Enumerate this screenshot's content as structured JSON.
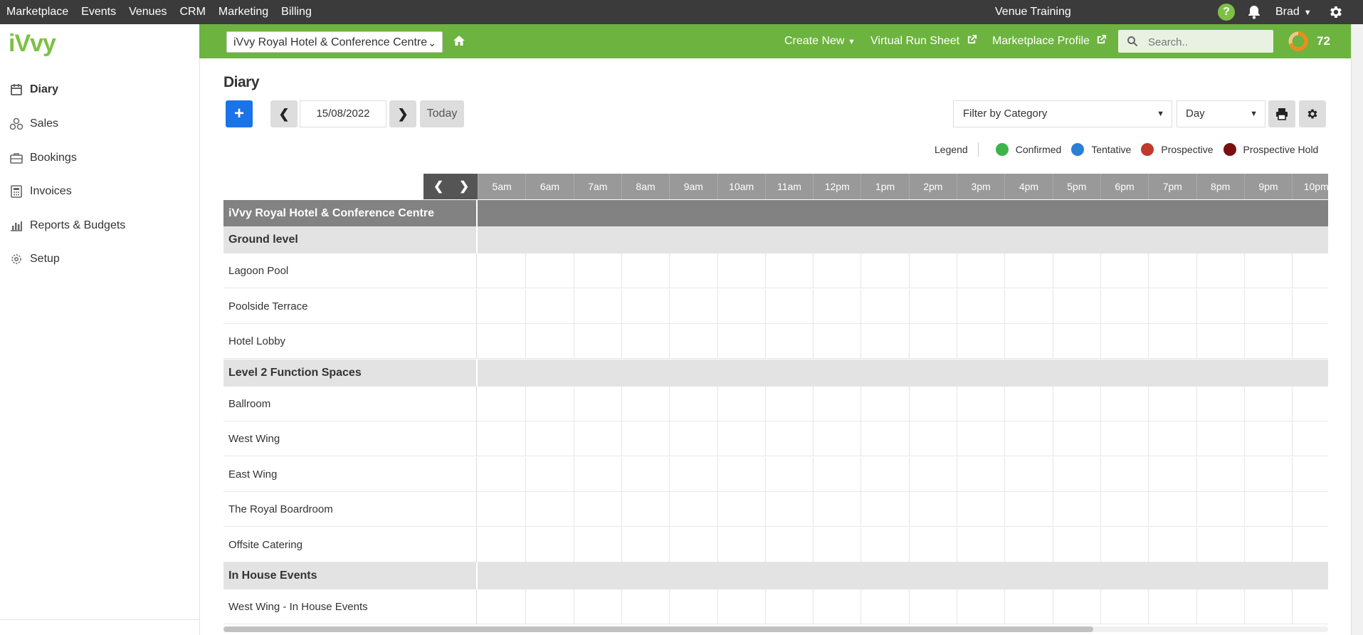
{
  "topnav": {
    "links": [
      "Marketplace",
      "Events",
      "Venues",
      "CRM",
      "Marketing",
      "Billing"
    ],
    "center_title": "Venue Training",
    "help_label": "?",
    "user": "Brad"
  },
  "sidebar": {
    "logo": "iVvy",
    "items": [
      {
        "label": "Diary",
        "icon": "calendar-icon",
        "active": true
      },
      {
        "label": "Sales",
        "icon": "sales-icon",
        "active": false
      },
      {
        "label": "Bookings",
        "icon": "briefcase-icon",
        "active": false
      },
      {
        "label": "Invoices",
        "icon": "calculator-icon",
        "active": false
      },
      {
        "label": "Reports & Budgets",
        "icon": "bar-chart-icon",
        "active": false
      },
      {
        "label": "Setup",
        "icon": "gear-icon",
        "active": false
      }
    ]
  },
  "greenbar": {
    "venue": "iVvy Royal Hotel & Conference Centre",
    "create_new": "Create New",
    "virtual_run_sheet": "Virtual Run Sheet",
    "marketplace_profile": "Marketplace Profile",
    "search_placeholder": "Search..",
    "score": "72"
  },
  "diary": {
    "title": "Diary",
    "add_label": "+",
    "date": "15/08/2022",
    "today_label": "Today",
    "filter_label": "Filter by Category",
    "view_label": "Day"
  },
  "legend": {
    "title": "Legend",
    "items": [
      {
        "label": "Confirmed",
        "color": "#3db34a"
      },
      {
        "label": "Tentative",
        "color": "#2a7fd4"
      },
      {
        "label": "Prospective",
        "color": "#c0392b"
      },
      {
        "label": "Prospective Hold",
        "color": "#7a1010"
      }
    ]
  },
  "grid": {
    "times": [
      "5am",
      "6am",
      "7am",
      "8am",
      "9am",
      "10am",
      "11am",
      "12pm",
      "1pm",
      "2pm",
      "3pm",
      "4pm",
      "5pm",
      "6pm",
      "7pm",
      "8pm",
      "9pm",
      "10pm"
    ],
    "venue_name": "iVvy Royal Hotel & Conference Centre",
    "groups": [
      {
        "name": "Ground level",
        "rooms": [
          "Lagoon Pool",
          "Poolside Terrace",
          "Hotel Lobby"
        ]
      },
      {
        "name": "Level 2 Function Spaces",
        "rooms": [
          "Ballroom",
          "West Wing",
          "East Wing",
          "The Royal Boardroom",
          "Offsite Catering"
        ]
      },
      {
        "name": "In House Events",
        "rooms": [
          "West Wing - In House Events"
        ]
      }
    ]
  }
}
